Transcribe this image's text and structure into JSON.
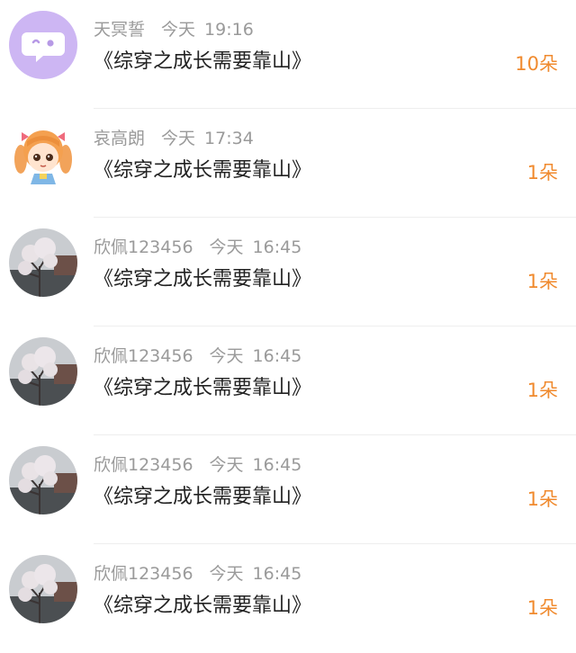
{
  "accent_color": "#f08a2e",
  "records": [
    {
      "user": "天冥誓",
      "day": "今天",
      "time": "19:16",
      "book": "《综穿之成长需要靠山》",
      "count": "10朵",
      "avatar_icon": "purple-chat-bubble-icon"
    },
    {
      "user": "哀高朗",
      "day": "今天",
      "time": "17:34",
      "book": "《综穿之成长需要靠山》",
      "count": "1朵",
      "avatar_icon": "cartoon-girl-icon"
    },
    {
      "user": "欣佩123456",
      "day": "今天",
      "time": "16:45",
      "book": "《综穿之成长需要靠山》",
      "count": "1朵",
      "avatar_icon": "blossom-tree-photo"
    },
    {
      "user": "欣佩123456",
      "day": "今天",
      "time": "16:45",
      "book": "《综穿之成长需要靠山》",
      "count": "1朵",
      "avatar_icon": "blossom-tree-photo"
    },
    {
      "user": "欣佩123456",
      "day": "今天",
      "time": "16:45",
      "book": "《综穿之成长需要靠山》",
      "count": "1朵",
      "avatar_icon": "blossom-tree-photo"
    },
    {
      "user": "欣佩123456",
      "day": "今天",
      "time": "16:45",
      "book": "《综穿之成长需要靠山》",
      "count": "1朵",
      "avatar_icon": "blossom-tree-photo"
    }
  ]
}
